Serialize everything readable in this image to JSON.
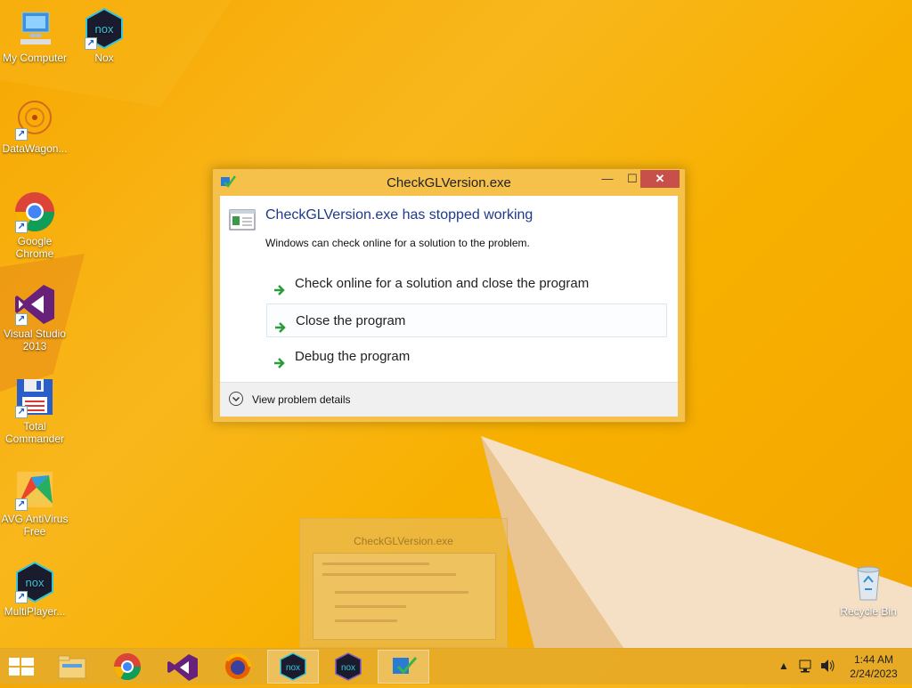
{
  "desktop": {
    "icons": [
      {
        "label": "My Computer",
        "icon": "computer-icon"
      },
      {
        "label": "Nox",
        "icon": "nox-icon"
      },
      {
        "label": "DataWagon...",
        "icon": "datawagon-icon"
      },
      {
        "label": "Google Chrome",
        "icon": "chrome-icon"
      },
      {
        "label": "Visual Studio 2013",
        "icon": "visual-studio-icon"
      },
      {
        "label": "Total Commander",
        "icon": "floppy-icon"
      },
      {
        "label": "AVG AntiVirus Free",
        "icon": "avg-icon"
      },
      {
        "label": "MultiPlayer...",
        "icon": "nox-multiplayer-icon"
      },
      {
        "label": "Recycle Bin",
        "icon": "recycle-bin-icon"
      }
    ]
  },
  "dialog": {
    "title": "CheckGLVersion.exe",
    "heading": "CheckGLVersion.exe has stopped working",
    "subtext": "Windows can check online for a solution to the problem.",
    "options": [
      "Check online for a solution and close the program",
      "Close the program",
      "Debug the program"
    ],
    "details_label": "View problem details",
    "minimize_glyph": "—",
    "maximize_glyph": "☐",
    "close_glyph": "✕"
  },
  "ghost": {
    "title": "CheckGLVersion.exe"
  },
  "taskbar": {
    "items": [
      "start-button",
      "file-explorer",
      "chrome",
      "visual-studio",
      "firefox",
      "nox",
      "nox-multiplayer",
      "checkglversion"
    ],
    "clock_time": "1:44 AM",
    "clock_date": "2/24/2023",
    "tray_chevron": "▲"
  },
  "colors": {
    "accent_close": "#c7504b",
    "heading_blue": "#1f3a8a",
    "arrow_green": "#2a9d3a"
  }
}
